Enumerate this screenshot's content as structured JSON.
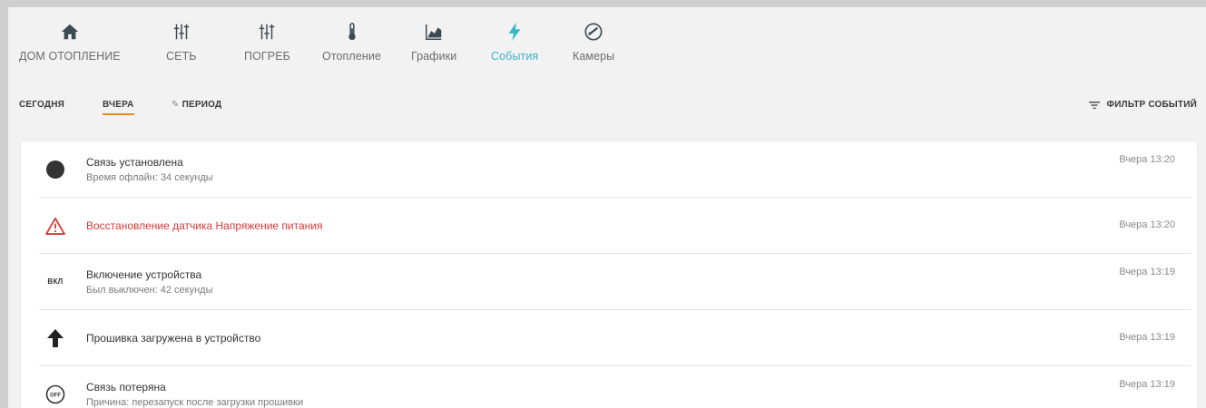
{
  "nav": {
    "items": [
      {
        "label": "ДОМ ОТОПЛЕНИЕ",
        "icon": "home-icon",
        "active": false
      },
      {
        "label": "СЕТЬ",
        "icon": "sliders-icon",
        "active": false
      },
      {
        "label": "ПОГРЕБ",
        "icon": "sliders-icon",
        "active": false
      },
      {
        "label": "Отопление",
        "icon": "thermometer-icon",
        "active": false
      },
      {
        "label": "Графики",
        "icon": "chart-icon",
        "active": false
      },
      {
        "label": "События",
        "icon": "lightning-icon",
        "active": true
      },
      {
        "label": "Камеры",
        "icon": "speedometer-icon",
        "active": false
      }
    ]
  },
  "tabs": {
    "today": "СЕГОДНЯ",
    "yesterday": "ВЧЕРА",
    "period": "ПЕРИОД",
    "selected": "yesterday"
  },
  "filter": {
    "label": "ФИЛЬТР СОБЫТИЙ",
    "icon": "filter-icon"
  },
  "events": [
    {
      "icon": "dot-icon",
      "title": "Связь установлена",
      "subtitle": "Время офлайн: 34 секунды",
      "time": "Вчера 13:20",
      "alert": false
    },
    {
      "icon": "warning-icon",
      "title": "Восстановление датчика Напряжение питания",
      "subtitle": "",
      "time": "Вчера 13:20",
      "alert": true
    },
    {
      "icon": "power-off-icon",
      "icon_text": "ВКЛ",
      "title": "Включение устройства",
      "subtitle": "Был выключен: 42 секунды",
      "time": "Вчера 13:19",
      "alert": false
    },
    {
      "icon": "arrow-up-icon",
      "title": "Прошивка загружена в устройство",
      "subtitle": "",
      "time": "Вчера 13:19",
      "alert": false
    },
    {
      "icon": "off-circle-icon",
      "icon_text": "OFF",
      "title": "Связь потеряна",
      "subtitle": "Причина: перезапуск после загрузки прошивки",
      "time": "Вчера 13:19",
      "alert": false
    }
  ],
  "colors": {
    "accent": "#38b6c9",
    "tab_underline": "#e98c1e",
    "alert": "#d83a3a"
  }
}
